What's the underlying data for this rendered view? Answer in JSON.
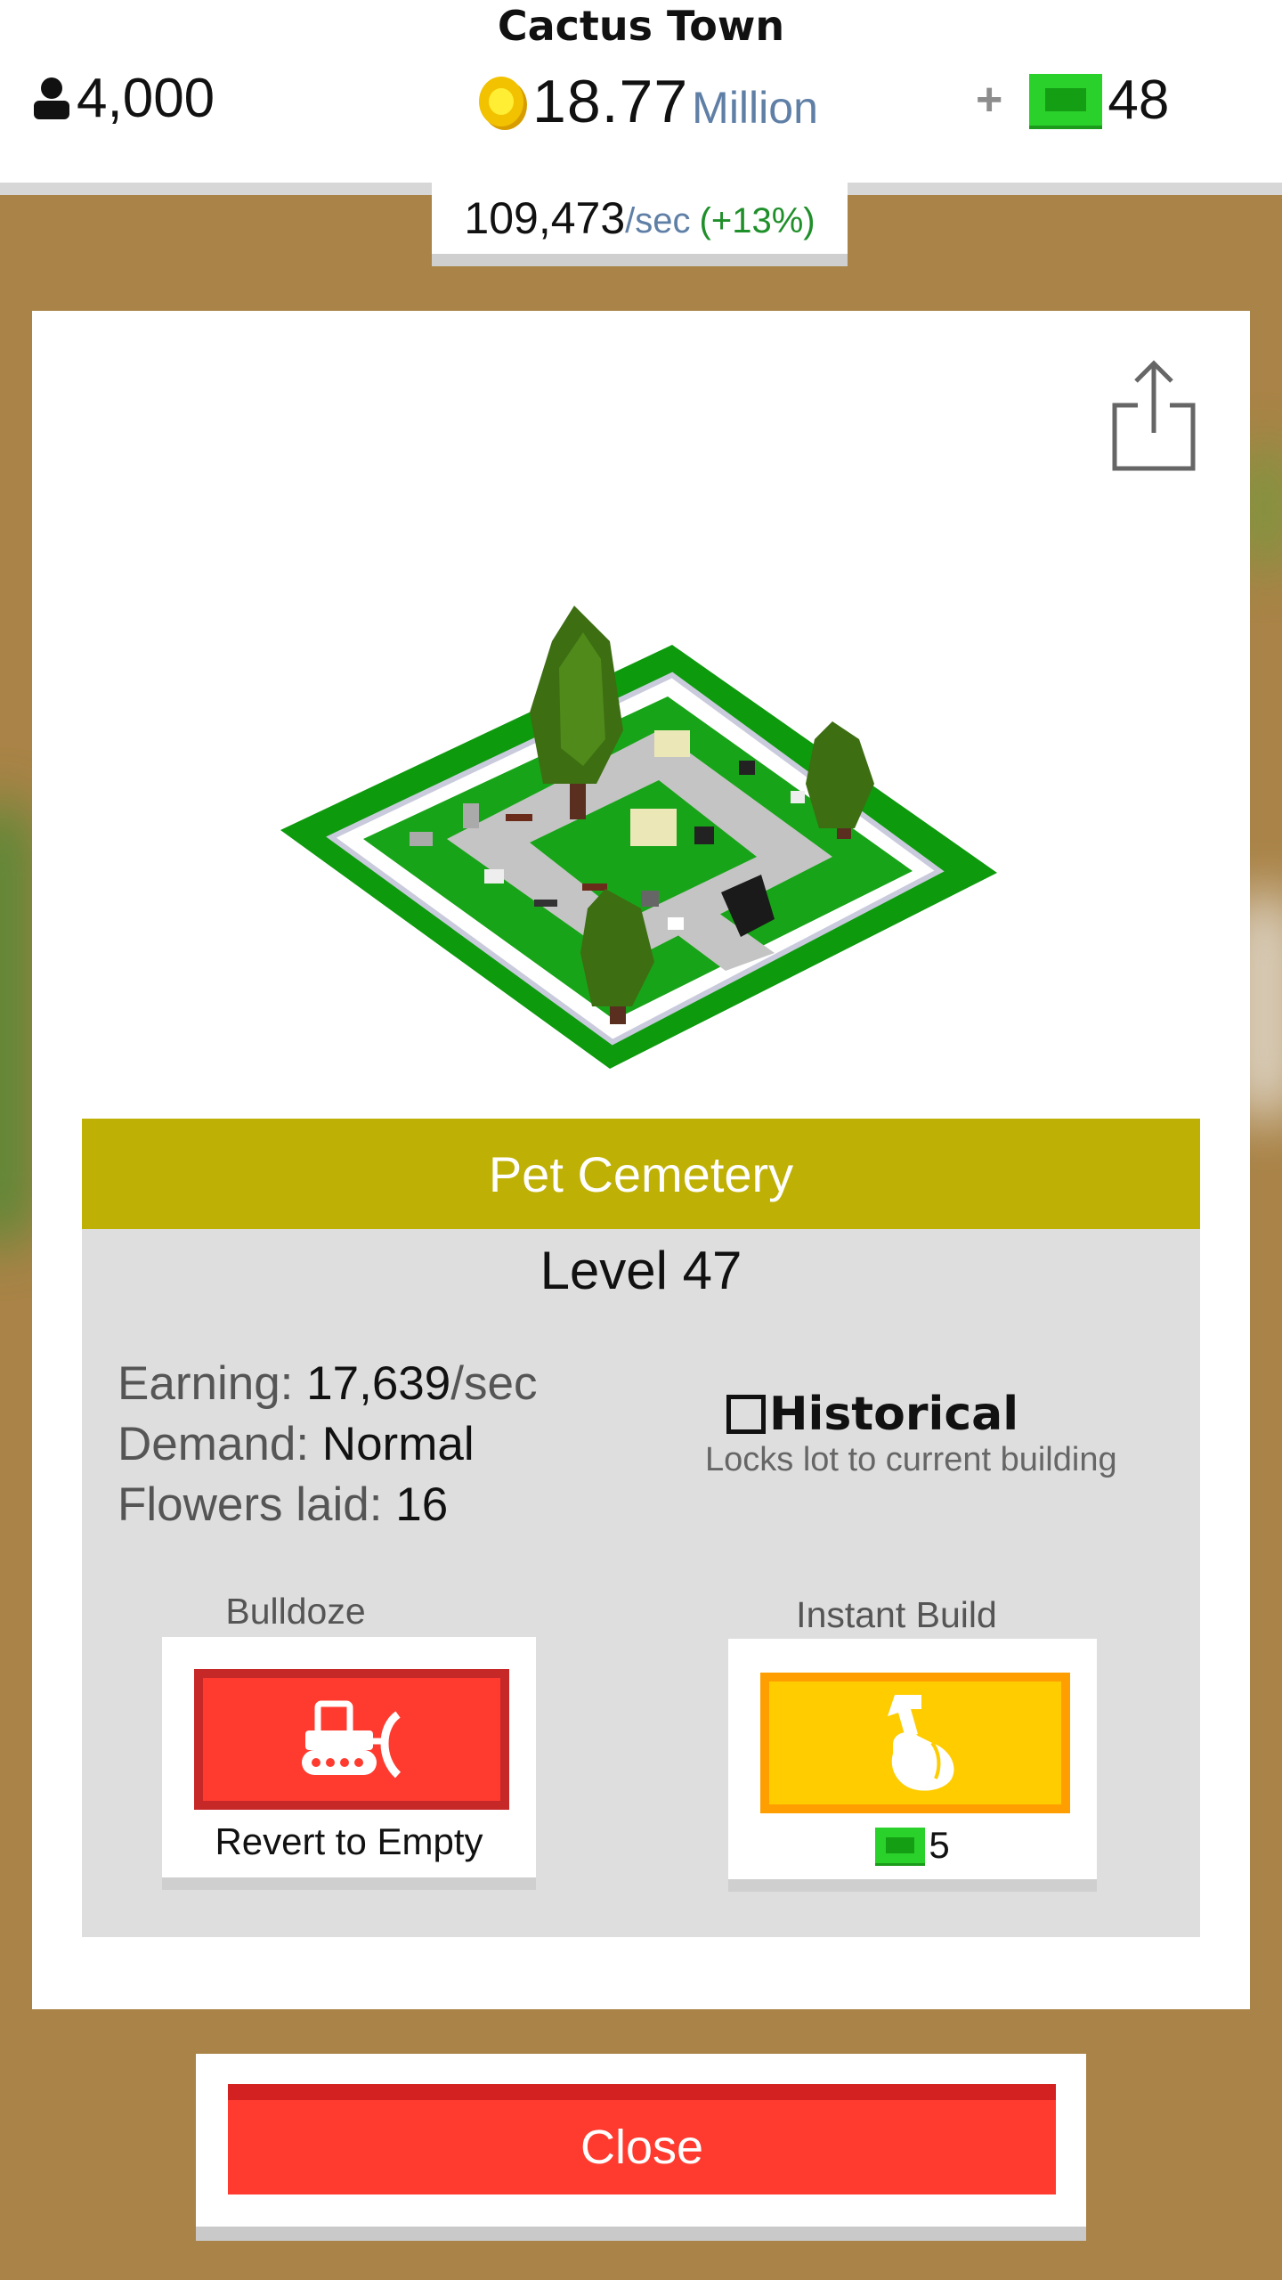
{
  "town": {
    "name": "Cactus Town"
  },
  "header": {
    "population": "4,000",
    "money_amount": "18.77",
    "money_unit": "Million",
    "plus_label": "+",
    "gems": "48",
    "rate_value": "109,473",
    "rate_unit": "/sec",
    "rate_bonus": "(+13%)"
  },
  "building": {
    "name": "Pet Cemetery",
    "level": "Level 47",
    "earning_label": "Earning:",
    "earning_value": "17,639",
    "earning_unit": "/sec",
    "demand_label": "Demand:",
    "demand_value": "Normal",
    "flowers_label": "Flowers laid:",
    "flowers_value": "16"
  },
  "historical": {
    "label": "Historical",
    "checked": false,
    "description": "Locks lot to current building"
  },
  "actions": {
    "bulldoze_label": "Bulldoze",
    "bulldoze_caption": "Revert to Empty",
    "instant_build_label": "Instant Build",
    "instant_build_cost": "5"
  },
  "close_label": "Close",
  "icons": [
    "person-icon",
    "coin-icon",
    "gem-icon",
    "share-icon",
    "bulldozer-icon",
    "hammer-hand-icon"
  ],
  "colors": {
    "title_bar": "#bfb005",
    "danger": "#ff3b30",
    "gold": "#ffcc00",
    "gem": "#2bd12b",
    "bonus_green": "#1f8f2a"
  }
}
